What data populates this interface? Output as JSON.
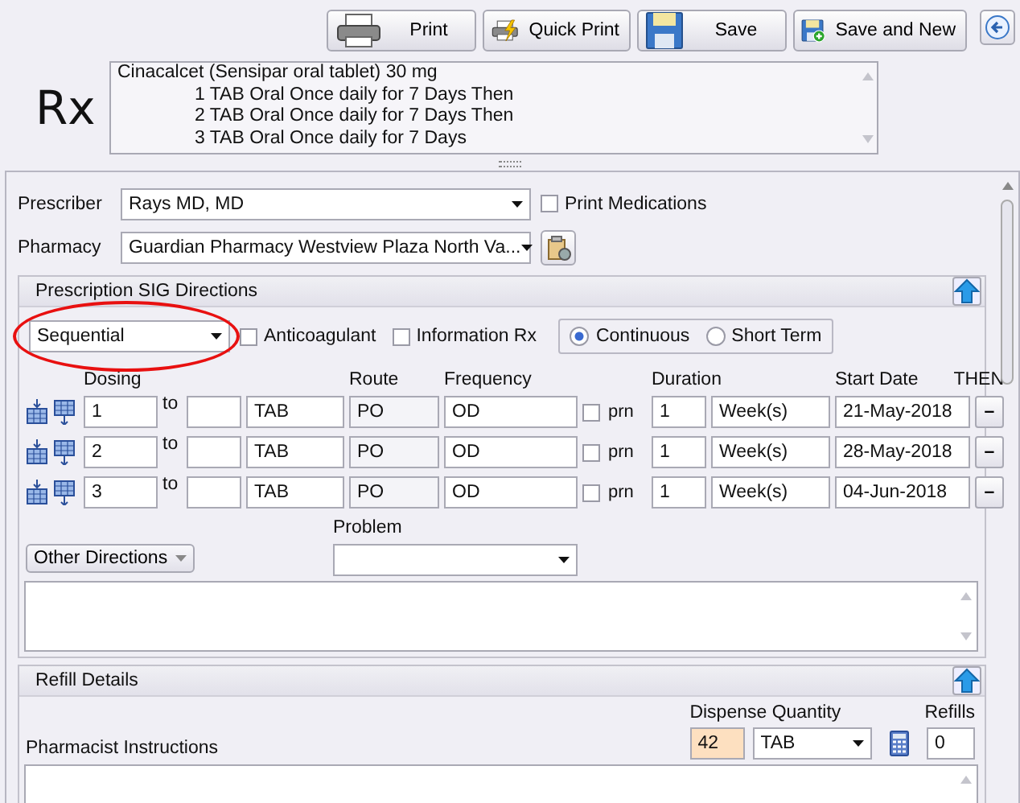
{
  "toolbar": {
    "buttons": [
      {
        "label": "Print"
      },
      {
        "label": "Quick Print"
      },
      {
        "label": "Save"
      },
      {
        "label": "Save and New"
      }
    ]
  },
  "rx": {
    "symbol": "Rx",
    "lines": [
      {
        "text": "Cinacalcet (Sensipar oral tablet) 30 mg",
        "kind": "drug"
      },
      {
        "text": "1 TAB Oral Once daily for 7 Days Then",
        "kind": "step"
      },
      {
        "text": "2 TAB Oral Once daily for 7 Days Then",
        "kind": "step"
      },
      {
        "text": "3 TAB Oral Once daily for 7 Days",
        "kind": "step"
      }
    ]
  },
  "prescriber": {
    "label": "Prescriber",
    "value": "Rays MD, MD"
  },
  "print_medications": {
    "label": "Print Medications",
    "checked": false
  },
  "pharmacy": {
    "label": "Pharmacy",
    "value": "Guardian Pharmacy Westview Plaza North Va..."
  },
  "sig": {
    "title": "Prescription SIG Directions",
    "mode": "Sequential",
    "mode_circled": true,
    "options": [
      {
        "label": "Anticoagulant",
        "checked": false
      },
      {
        "label": "Information Rx",
        "checked": false
      }
    ],
    "duration_type": [
      {
        "label": "Continuous",
        "selected": true
      },
      {
        "label": "Short Term",
        "selected": false
      }
    ],
    "columns": {
      "dosing": "Dosing",
      "route": "Route",
      "frequency": "Frequency",
      "duration": "Duration",
      "start_date": "Start Date",
      "then": "THEN"
    },
    "rows": [
      {
        "dose_from": "1",
        "to": "to",
        "unit": "TAB",
        "route": "PO",
        "frequency": "OD",
        "prn": false,
        "prn_label": "prn",
        "duration": "1",
        "duration_unit": "Week(s)",
        "start_date": "21-May-2018",
        "remove": "–"
      },
      {
        "dose_from": "2",
        "to": "to",
        "unit": "TAB",
        "route": "PO",
        "frequency": "OD",
        "prn": false,
        "prn_label": "prn",
        "duration": "1",
        "duration_unit": "Week(s)",
        "start_date": "28-May-2018",
        "remove": "–"
      },
      {
        "dose_from": "3",
        "to": "to",
        "unit": "TAB",
        "route": "PO",
        "frequency": "OD",
        "prn": false,
        "prn_label": "prn",
        "duration": "1",
        "duration_unit": "Week(s)",
        "start_date": "04-Jun-2018",
        "remove": "–"
      }
    ],
    "other_directions": "Other Directions",
    "problem_label": "Problem"
  },
  "refill": {
    "title": "Refill Details",
    "pharmacist_instructions": "Pharmacist Instructions",
    "dispense_label": "Dispense Quantity",
    "quantity": "42",
    "quantity_unit": "TAB",
    "refills_label": "Refills",
    "refills": "0"
  }
}
